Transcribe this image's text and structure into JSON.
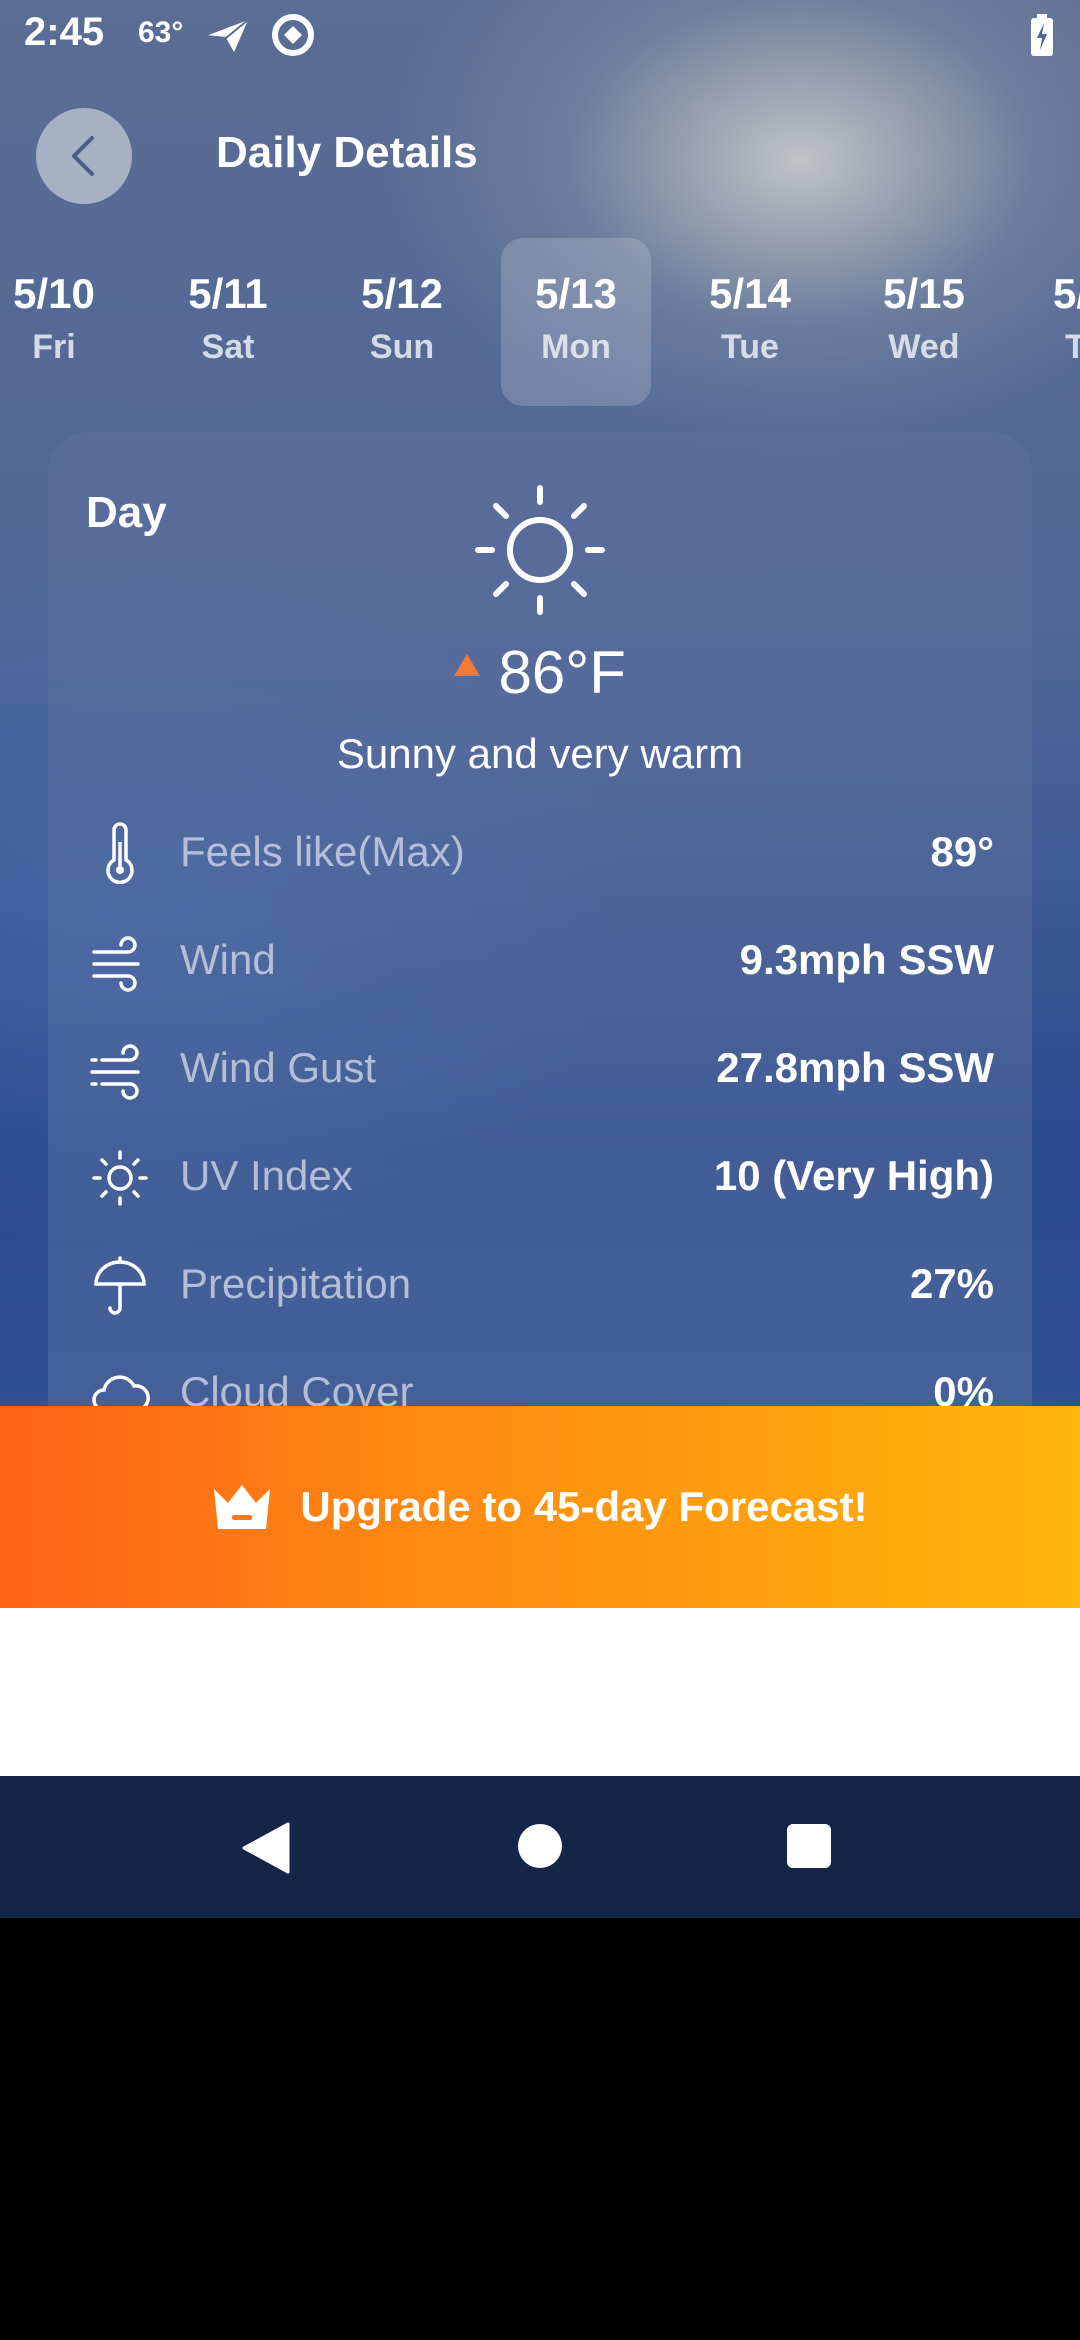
{
  "status_bar": {
    "time": "2:45",
    "temperature": "63°"
  },
  "header": {
    "title": "Daily Details"
  },
  "dates": [
    {
      "date": "5/10",
      "weekday": "Fri",
      "selected": false
    },
    {
      "date": "5/11",
      "weekday": "Sat",
      "selected": false
    },
    {
      "date": "5/12",
      "weekday": "Sun",
      "selected": false
    },
    {
      "date": "5/13",
      "weekday": "Mon",
      "selected": true
    },
    {
      "date": "5/14",
      "weekday": "Tue",
      "selected": false
    },
    {
      "date": "5/15",
      "weekday": "Wed",
      "selected": false
    },
    {
      "date": "5/",
      "weekday": "T",
      "selected": false
    }
  ],
  "card": {
    "label": "Day",
    "icon": "sun-icon",
    "temperature": "86°F",
    "condition": "Sunny and very warm",
    "details": [
      {
        "icon": "thermometer-icon",
        "label": "Feels like(Max)",
        "value": "89°"
      },
      {
        "icon": "wind-icon",
        "label": "Wind",
        "value": "9.3mph SSW"
      },
      {
        "icon": "wind-gust-icon",
        "label": "Wind Gust",
        "value": "27.8mph SSW"
      },
      {
        "icon": "uv-index-icon",
        "label": "UV Index",
        "value": "10 (Very High)"
      },
      {
        "icon": "umbrella-icon",
        "label": "Precipitation",
        "value": "27%"
      },
      {
        "icon": "cloud-icon",
        "label": "Cloud Cover",
        "value": "0%"
      }
    ]
  },
  "banner": {
    "icon": "crown-icon",
    "text": "Upgrade to 45-day Forecast!"
  },
  "colors": {
    "accent_orange": "#f47a3a",
    "banner_start": "#ff6216",
    "banner_end": "#ffb50a",
    "nav_bar": "#14254a"
  }
}
